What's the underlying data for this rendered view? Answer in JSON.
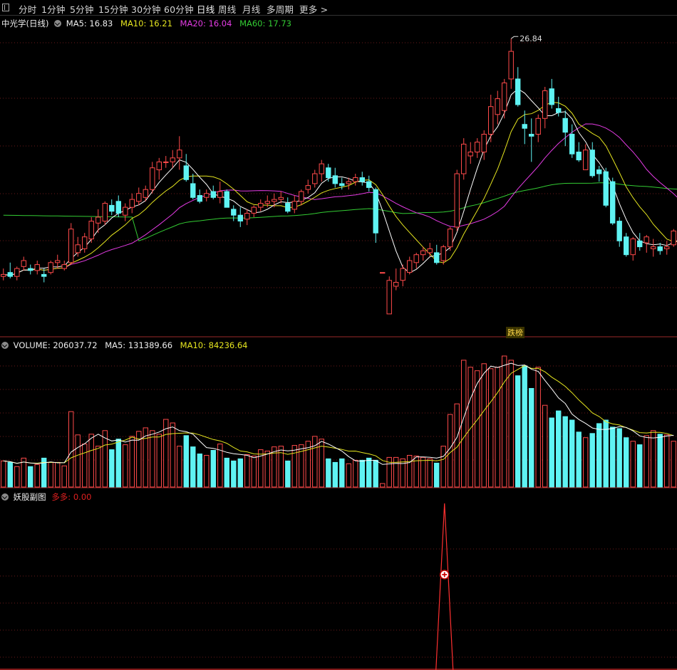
{
  "toolbar": {
    "timeframes": [
      "分时",
      "1分钟",
      "5分钟",
      "15分钟",
      "30分钟",
      "60分钟",
      "日线",
      "周线",
      "月线",
      "多周期",
      "更多"
    ],
    "active": "日线"
  },
  "price_panel": {
    "title": "中光学(日线)",
    "ma5": "MA5: 16.83",
    "ma10": "MA10: 16.21",
    "ma20": "MA20: 16.04",
    "ma60": "MA60: 17.73",
    "high_label": "26.84",
    "badge": "跌榜",
    "colors": {
      "ma5": "#ffffff",
      "ma10": "#e5e51f",
      "ma20": "#e43be4",
      "ma60": "#33cc33",
      "up": "#ff4a4a",
      "down": "#5ff3f3"
    }
  },
  "volume_panel": {
    "volume": "VOLUME: 206037.72",
    "ma5": "MA5: 131389.66",
    "ma10": "MA10: 84236.64"
  },
  "indicator_panel": {
    "title": "妖股副图",
    "series": "多多: 0.00"
  },
  "chart_data": {
    "type": "candlestick",
    "price_ylim": [
      12.5,
      27.5
    ],
    "candles": [
      [
        14.8,
        15.2,
        14.6,
        14.9
      ],
      [
        15.0,
        15.5,
        14.7,
        14.8
      ],
      [
        14.8,
        15.3,
        14.6,
        15.2
      ],
      [
        15.3,
        15.8,
        15.1,
        15.6
      ],
      [
        15.2,
        15.4,
        14.9,
        15.1
      ],
      [
        15.1,
        15.6,
        14.9,
        15.4
      ],
      [
        14.9,
        15.2,
        14.5,
        14.8
      ],
      [
        15.0,
        15.6,
        14.9,
        15.5
      ],
      [
        15.5,
        15.9,
        15.2,
        15.6
      ],
      [
        15.2,
        15.6,
        15.1,
        15.4
      ],
      [
        15.5,
        17.5,
        15.4,
        17.2
      ],
      [
        16.0,
        16.8,
        15.8,
        16.4
      ],
      [
        16.2,
        17.0,
        16.0,
        16.8
      ],
      [
        16.7,
        17.8,
        16.5,
        17.6
      ],
      [
        17.5,
        18.2,
        17.0,
        17.8
      ],
      [
        17.6,
        18.6,
        17.4,
        18.5
      ],
      [
        18.4,
        18.7,
        17.9,
        18.1
      ],
      [
        18.6,
        18.9,
        17.8,
        18.0
      ],
      [
        17.9,
        18.5,
        17.6,
        18.3
      ],
      [
        18.3,
        19.0,
        18.0,
        18.7
      ],
      [
        18.6,
        19.3,
        18.4,
        19.0
      ],
      [
        18.8,
        19.4,
        18.6,
        19.2
      ],
      [
        19.2,
        20.6,
        19.0,
        20.3
      ],
      [
        20.2,
        20.8,
        19.7,
        20.6
      ],
      [
        20.6,
        20.9,
        20.3,
        20.6
      ],
      [
        20.6,
        21.2,
        20.3,
        20.8
      ],
      [
        20.8,
        21.9,
        20.2,
        21.2
      ],
      [
        20.4,
        21.0,
        19.6,
        19.7
      ],
      [
        19.5,
        20.0,
        18.7,
        18.8
      ],
      [
        18.9,
        19.2,
        18.5,
        18.6
      ],
      [
        18.8,
        19.2,
        18.6,
        19.0
      ],
      [
        19.1,
        19.4,
        18.7,
        18.8
      ],
      [
        18.8,
        19.6,
        18.5,
        19.1
      ],
      [
        19.1,
        19.2,
        18.3,
        18.3
      ],
      [
        18.2,
        18.4,
        17.6,
        17.9
      ],
      [
        17.9,
        18.3,
        17.3,
        17.6
      ],
      [
        17.7,
        18.2,
        17.4,
        18.0
      ],
      [
        18.0,
        18.4,
        17.8,
        18.3
      ],
      [
        18.3,
        18.7,
        18.1,
        18.5
      ],
      [
        18.5,
        18.9,
        18.3,
        18.6
      ],
      [
        18.6,
        19.0,
        18.3,
        18.7
      ],
      [
        18.7,
        19.1,
        18.5,
        18.8
      ],
      [
        18.5,
        18.8,
        18.0,
        18.1
      ],
      [
        18.2,
        18.9,
        18.0,
        18.6
      ],
      [
        18.6,
        19.2,
        18.4,
        19.1
      ],
      [
        19.2,
        19.7,
        19.0,
        19.4
      ],
      [
        19.5,
        20.2,
        19.3,
        20.0
      ],
      [
        20.0,
        20.7,
        19.6,
        20.5
      ],
      [
        20.3,
        20.5,
        19.6,
        19.8
      ],
      [
        19.9,
        20.3,
        19.3,
        19.5
      ],
      [
        19.5,
        19.8,
        19.2,
        19.4
      ],
      [
        19.5,
        19.8,
        19.2,
        19.6
      ],
      [
        19.6,
        20.0,
        19.4,
        19.8
      ],
      [
        19.8,
        20.1,
        19.4,
        19.6
      ],
      [
        19.6,
        19.9,
        19.1,
        19.3
      ],
      [
        19.2,
        19.3,
        16.5,
        17.0
      ],
      [
        15.0,
        15.0,
        15.0,
        15.0
      ],
      [
        12.9,
        14.8,
        12.9,
        14.6
      ],
      [
        14.3,
        15.2,
        14.1,
        14.5
      ],
      [
        14.6,
        15.4,
        14.3,
        15.2
      ],
      [
        15.0,
        15.8,
        14.9,
        15.6
      ],
      [
        15.5,
        16.0,
        15.2,
        15.9
      ],
      [
        15.9,
        16.3,
        15.6,
        16.1
      ],
      [
        16.0,
        16.5,
        15.8,
        16.2
      ],
      [
        16.0,
        16.4,
        15.4,
        15.5
      ],
      [
        15.6,
        16.4,
        15.4,
        16.3
      ],
      [
        16.3,
        17.3,
        16.1,
        17.2
      ],
      [
        17.3,
        20.2,
        17.1,
        20.0
      ],
      [
        20.0,
        21.8,
        19.7,
        21.5
      ],
      [
        20.9,
        21.6,
        20.5,
        21.1
      ],
      [
        21.1,
        21.8,
        20.8,
        21.6
      ],
      [
        21.1,
        22.2,
        20.7,
        22.0
      ],
      [
        22.0,
        24.0,
        21.6,
        23.4
      ],
      [
        23.0,
        24.2,
        22.5,
        23.8
      ],
      [
        23.2,
        24.8,
        22.8,
        24.6
      ],
      [
        24.8,
        26.84,
        24.3,
        26.2
      ],
      [
        24.8,
        25.4,
        23.4,
        23.5
      ],
      [
        22.5,
        23.2,
        21.5,
        22.3
      ],
      [
        22.0,
        22.8,
        20.6,
        21.9
      ],
      [
        22.0,
        23.0,
        21.6,
        22.8
      ],
      [
        22.8,
        24.4,
        22.3,
        24.2
      ],
      [
        24.3,
        24.8,
        23.3,
        23.5
      ],
      [
        23.3,
        23.9,
        22.9,
        23.1
      ],
      [
        22.8,
        23.2,
        21.4,
        22.1
      ],
      [
        22.0,
        22.5,
        20.8,
        21.0
      ],
      [
        21.1,
        21.6,
        20.6,
        20.7
      ],
      [
        20.2,
        21.5,
        20.2,
        21.2
      ],
      [
        21.2,
        21.6,
        19.8,
        19.9
      ],
      [
        20.2,
        20.4,
        19.6,
        20.0
      ],
      [
        20.1,
        20.3,
        18.3,
        18.4
      ],
      [
        19.6,
        19.8,
        17.4,
        17.5
      ],
      [
        17.6,
        17.8,
        16.3,
        16.6
      ],
      [
        16.8,
        17.0,
        15.8,
        15.9
      ],
      [
        15.9,
        16.8,
        15.6,
        16.7
      ],
      [
        16.6,
        17.0,
        16.1,
        16.3
      ],
      [
        16.5,
        16.9,
        16.0,
        16.8
      ],
      [
        16.2,
        16.7,
        15.8,
        16.3
      ],
      [
        16.3,
        16.5,
        15.9,
        16.1
      ],
      [
        16.2,
        16.6,
        15.9,
        16.3
      ],
      [
        16.4,
        17.2,
        16.3,
        17.1
      ],
      [
        17.3,
        18.0,
        17.0,
        17.6
      ],
      [
        17.1,
        17.6,
        16.2,
        16.4
      ],
      [
        15.8,
        15.8,
        15.0,
        15.0
      ],
      [
        14.8,
        15.0,
        14.5,
        14.6
      ]
    ],
    "volume": [
      37,
      35,
      29,
      41,
      29,
      32,
      41,
      35,
      35,
      30,
      107,
      74,
      61,
      75,
      58,
      80,
      53,
      68,
      60,
      72,
      79,
      84,
      80,
      75,
      96,
      91,
      58,
      73,
      57,
      47,
      45,
      52,
      61,
      41,
      37,
      40,
      46,
      44,
      53,
      51,
      57,
      58,
      37,
      59,
      60,
      65,
      72,
      68,
      40,
      35,
      40,
      33,
      38,
      38,
      41,
      38,
      5,
      42,
      42,
      40,
      45,
      44,
      42,
      40,
      34,
      58,
      103,
      118,
      180,
      170,
      165,
      175,
      168,
      170,
      186,
      180,
      158,
      172,
      140,
      170,
      116,
      98,
      108,
      100,
      95,
      78,
      70,
      76,
      90,
      95,
      85,
      83,
      70,
      65,
      60,
      73,
      80,
      75,
      74,
      65
    ],
    "indicator": {
      "name": "多多",
      "peak_index": 62,
      "peak_value": 1,
      "value": 0.0
    }
  }
}
